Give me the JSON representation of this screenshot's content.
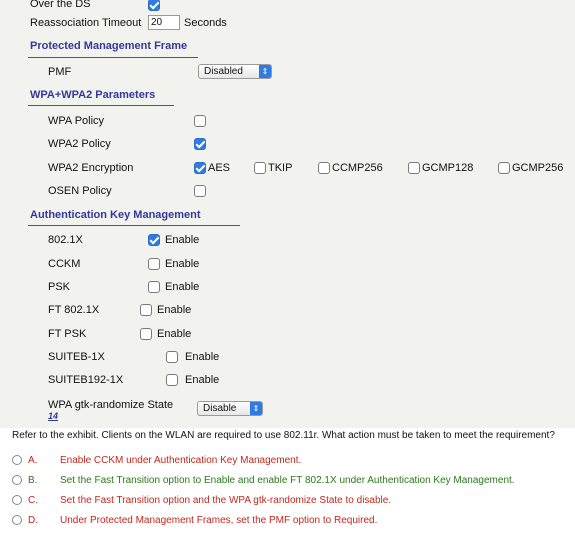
{
  "form": {
    "over_the_ds_label": "Over the DS",
    "reassoc_label": "Reassociation Timeout",
    "reassoc_value": "20",
    "reassoc_unit": "Seconds",
    "pmf_section": "Protected Management Frame",
    "pmf_label": "PMF",
    "pmf_value": "Disabled",
    "wpa_section": "WPA+WPA2 Parameters",
    "wpa_policy_label": "WPA Policy",
    "wpa2_policy_label": "WPA2 Policy",
    "wpa2_encryption_label": "WPA2 Encryption",
    "enc_aes": "AES",
    "enc_tkip": "TKIP",
    "enc_ccmp256": "CCMP256",
    "enc_gcmp128": "GCMP128",
    "enc_gcmp256": "GCMP256",
    "osen_label": "OSEN Policy",
    "akm_section": "Authentication Key Management",
    "akm_rows": [
      {
        "label": "802.1X",
        "value": "Enable",
        "checked": true
      },
      {
        "label": "CCKM",
        "value": "Enable",
        "checked": false
      },
      {
        "label": "PSK",
        "value": "Enable",
        "checked": false
      },
      {
        "label": "FT 802.1X",
        "value": "Enable",
        "checked": false
      },
      {
        "label": "FT PSK",
        "value": "Enable",
        "checked": false
      },
      {
        "label": "SUITEB-1X",
        "value": "Enable",
        "checked": false
      },
      {
        "label": "SUITEB192-1X",
        "value": "Enable",
        "checked": false
      }
    ],
    "gtk_label": "WPA gtk-randomize State",
    "gtk_footnote": "14",
    "gtk_value": "Disable"
  },
  "question": {
    "text": "Refer to the exhibit. Clients on the WLAN are required to use 802.11r. What action must be taken to meet the requirement?",
    "options": [
      {
        "letter": "A.",
        "text": "Enable CCKM under Authentication Key Management."
      },
      {
        "letter": "B.",
        "text": "Set the Fast Transition option to Enable and enable FT 802.1X under Authentication Key Management."
      },
      {
        "letter": "C.",
        "text": "Set the Fast Transition option and the WPA gtk-randomize State to disable."
      },
      {
        "letter": "D.",
        "text": "Under Protected Management Frames, set the PMF option to Required."
      }
    ]
  },
  "colors": {
    "section_blue": "#33399a",
    "checkbox_blue": "#2f7be5",
    "option_red": "#c4271e",
    "option_green": "#2a7a1a"
  }
}
